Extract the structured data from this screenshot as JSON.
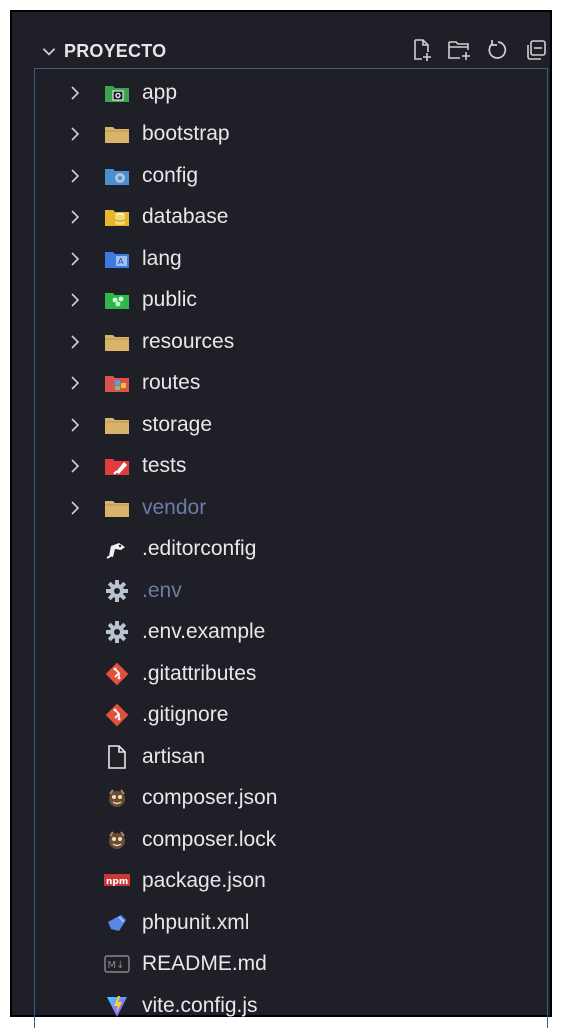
{
  "explorer": {
    "title": "PROYECTO",
    "actions": [
      {
        "name": "new-file-icon"
      },
      {
        "name": "new-folder-icon"
      },
      {
        "name": "refresh-icon"
      },
      {
        "name": "collapse-all-icon"
      }
    ],
    "items": [
      {
        "label": "app",
        "type": "folder",
        "icon": "app-folder-icon",
        "color": "#3fa34d"
      },
      {
        "label": "bootstrap",
        "type": "folder",
        "icon": "folder-icon",
        "color": "#d9b36a"
      },
      {
        "label": "config",
        "type": "folder",
        "icon": "config-folder-icon",
        "color": "#4a8fd6"
      },
      {
        "label": "database",
        "type": "folder",
        "icon": "database-folder-icon",
        "color": "#e8b62c"
      },
      {
        "label": "lang",
        "type": "folder",
        "icon": "lang-folder-icon",
        "color": "#3d7be0"
      },
      {
        "label": "public",
        "type": "folder",
        "icon": "public-folder-icon",
        "color": "#2fb84a"
      },
      {
        "label": "resources",
        "type": "folder",
        "icon": "folder-icon",
        "color": "#d9b36a"
      },
      {
        "label": "routes",
        "type": "folder",
        "icon": "routes-folder-icon",
        "color": "#d9534f"
      },
      {
        "label": "storage",
        "type": "folder",
        "icon": "folder-icon",
        "color": "#d9b36a"
      },
      {
        "label": "tests",
        "type": "folder",
        "icon": "tests-folder-icon",
        "color": "#e03c3c"
      },
      {
        "label": "vendor",
        "type": "folder",
        "icon": "folder-icon",
        "color": "#d9b36a",
        "dim": true
      },
      {
        "label": ".editorconfig",
        "type": "file",
        "icon": "editorconfig-icon",
        "color": "#f0f0f0"
      },
      {
        "label": ".env",
        "type": "file",
        "icon": "gear-icon",
        "color": "#b9c3cf",
        "dim": true
      },
      {
        "label": ".env.example",
        "type": "file",
        "icon": "gear-icon",
        "color": "#b9c3cf"
      },
      {
        "label": ".gitattributes",
        "type": "file",
        "icon": "git-icon",
        "color": "#e0513b"
      },
      {
        "label": ".gitignore",
        "type": "file",
        "icon": "git-icon",
        "color": "#e0513b"
      },
      {
        "label": "artisan",
        "type": "file",
        "icon": "file-icon",
        "color": "#e8e8e8"
      },
      {
        "label": "composer.json",
        "type": "file",
        "icon": "composer-icon",
        "color": "#8a6a4a"
      },
      {
        "label": "composer.lock",
        "type": "file",
        "icon": "composer-icon",
        "color": "#8a6a4a"
      },
      {
        "label": "package.json",
        "type": "file",
        "icon": "npm-icon",
        "color": "#cb3837"
      },
      {
        "label": "phpunit.xml",
        "type": "file",
        "icon": "phpunit-icon",
        "color": "#5a87e8"
      },
      {
        "label": "README.md",
        "type": "file",
        "icon": "markdown-icon",
        "color": "#8a8a8a"
      },
      {
        "label": "vite.config.js",
        "type": "file",
        "icon": "vite-icon",
        "color": "#9b5cf6"
      }
    ]
  }
}
